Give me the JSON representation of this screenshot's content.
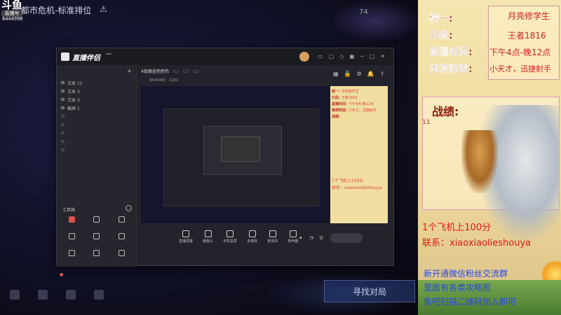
{
  "stream": {
    "logo_main": "斗鱼",
    "logo_sub": "直播号",
    "room_number": "8444990",
    "game_title": "都市危机-标准排位",
    "ping": "74"
  },
  "game": {
    "find_match": "寻找对局",
    "bottom_icons": [
      "",
      "",
      "",
      ""
    ],
    "hint": "",
    "warn_icon": "warning-icon"
  },
  "app": {
    "name": "直播伴侣",
    "badge": "",
    "window_icons": [
      "▭",
      "▢",
      "◇",
      "▣",
      "─",
      "□",
      "✕"
    ],
    "scene_tabs": [
      "",
      "",
      ""
    ],
    "sources": [
      {
        "name": "文本 11",
        "dim": false
      },
      {
        "name": "文本 3",
        "dim": false
      },
      {
        "name": "文本 3",
        "dim": false
      },
      {
        "name": "截屏 1",
        "dim": false
      },
      {
        "name": "",
        "dim": true
      },
      {
        "name": "",
        "dim": true
      },
      {
        "name": "",
        "dim": true
      },
      {
        "name": "",
        "dim": true
      },
      {
        "name": "",
        "dim": true
      }
    ],
    "toolbox_label": "工具箱",
    "tools": [
      {
        "label": "",
        "red": true
      },
      {
        "label": "",
        "red": false
      },
      {
        "label": "",
        "red": false
      },
      {
        "label": "",
        "red": false
      },
      {
        "label": "",
        "red": false
      },
      {
        "label": "",
        "red": false
      },
      {
        "label": "",
        "red": false
      },
      {
        "label": "",
        "red": false
      },
      {
        "label": "",
        "red": false
      }
    ],
    "hint_text": "",
    "info": {
      "title": "4级魔盗把把鸡",
      "chips": [
        "",
        "",
        ""
      ]
    },
    "stats": [
      "",
      "",
      "8444990",
      "1292"
    ],
    "bottom_controls": [
      "直播屏幕",
      "摄像头",
      "手机投屏",
      "多媒体",
      "麦克风",
      "扬声器"
    ],
    "go_live": ""
  },
  "preview_overlay": {
    "rows": [
      {
        "k": "榜一:",
        "v": "月亮修学生"
      },
      {
        "k": "分段:",
        "v": "王者1816"
      },
      {
        "k": "直播时间:",
        "v": "下午4点-晚12点"
      },
      {
        "k": "推荐阵容:",
        "v": "小天才，迅捷射手"
      }
    ],
    "record": "战绩:",
    "line1": "1个飞机上100分",
    "line2": "联系：xiaoxiaolieshouya"
  },
  "overlay": {
    "rank1_label": "榜一:",
    "rank1_value": "月亮修学生",
    "tier_label": "分段:",
    "tier_value": "王者1816",
    "time_label": "直播时间:",
    "time_value": "下午4点-晚12点",
    "lineup_label": "推荐阵容:",
    "lineup_value": "小天才，迅捷射手",
    "record_label": "战绩:",
    "record_value": "11",
    "promo_line1": "1个飞机上100分",
    "promo_line2": "联系：xiaoxiaolieshouya",
    "group_line1": "新开通微信粉丝交流群",
    "group_line2": "里面有各类攻略图",
    "group_line3": "鱼吧扫描二维码加入即可"
  }
}
